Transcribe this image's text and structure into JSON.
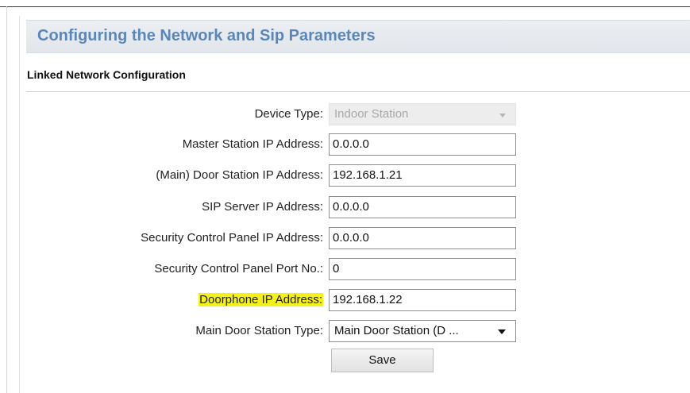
{
  "header": {
    "title": "Configuring the Network and Sip Parameters"
  },
  "section": {
    "title": "Linked Network Configuration"
  },
  "fields": {
    "device_type": {
      "label": "Device Type:",
      "value": "Indoor Station"
    },
    "master_ip": {
      "label": "Master Station IP Address:",
      "value": "0.0.0.0"
    },
    "main_door_ip": {
      "label": "(Main) Door Station IP Address:",
      "value": "192.168.1.21"
    },
    "sip_server_ip": {
      "label": "SIP Server IP Address:",
      "value": "0.0.0.0"
    },
    "security_panel_ip": {
      "label": "Security Control Panel IP Address:",
      "value": "0.0.0.0"
    },
    "security_panel_port": {
      "label": "Security Control Panel Port No.:",
      "value": "0"
    },
    "doorphone_ip": {
      "label": "Doorphone IP Address:",
      "value": "192.168.1.22"
    },
    "main_door_type": {
      "label": "Main Door Station Type:",
      "value": "Main Door Station (D ..."
    }
  },
  "actions": {
    "save_label": "Save"
  },
  "colors": {
    "header_text": "#5a87b8",
    "highlight": "#f5f01a"
  }
}
